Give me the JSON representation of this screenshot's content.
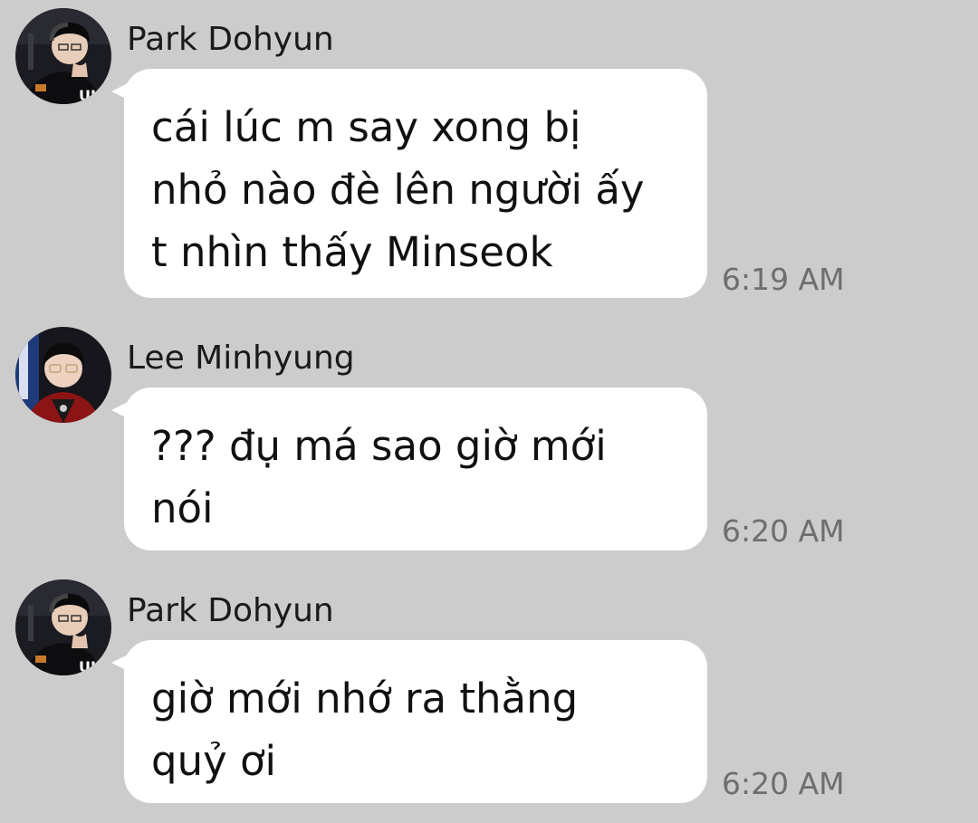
{
  "messages": [
    {
      "sender": "Park Dohyun",
      "avatar": "avatar-park-dohyun",
      "lines": [
        "cái lúc m say xong bị",
        "nhỏ nào đè lên người ấy",
        "t nhìn thấy Minseok"
      ],
      "time": "6:19 AM"
    },
    {
      "sender": "Lee Minhyung",
      "avatar": "avatar-lee-minhyung",
      "lines": [
        "??? đụ má sao giờ mới",
        "nói"
      ],
      "time": "6:20 AM"
    },
    {
      "sender": "Park Dohyun",
      "avatar": "avatar-park-dohyun",
      "lines": [
        "giờ mới nhớ ra thằng",
        "quỷ ơi"
      ],
      "time": "6:20 AM"
    }
  ],
  "colors": {
    "background": "#cccccc",
    "bubble": "#ffffff",
    "text": "#111111",
    "timestamp": "#6e6e6e"
  }
}
